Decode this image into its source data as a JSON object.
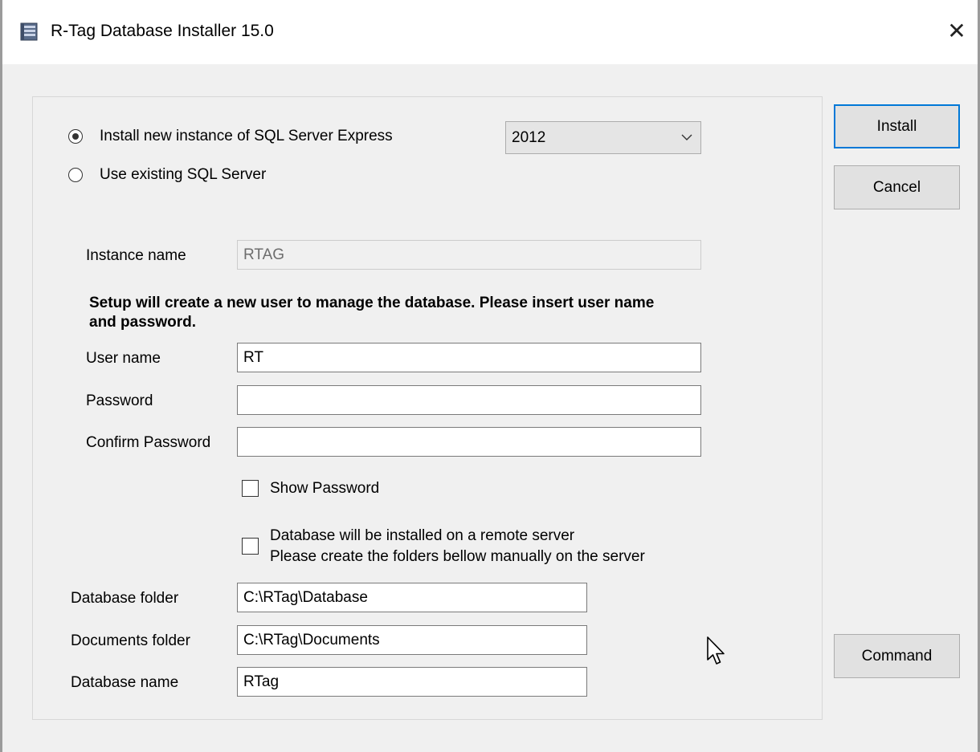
{
  "window": {
    "title": "R-Tag Database Installer 15.0",
    "close_glyph": "✕",
    "icon": "database-icon"
  },
  "install_mode": {
    "new_instance_label": "Install new instance of SQL Server Express",
    "existing_label": "Use existing SQL Server",
    "selected": "new_instance",
    "version_selected": "2012"
  },
  "instance": {
    "label": "Instance name",
    "value": "RTAG"
  },
  "note": "Setup will create a new user to manage the database. Please insert user name and password.",
  "user": {
    "username_label": "User name",
    "username_value": "RT",
    "password_label": "Password",
    "password_value": "",
    "confirm_label": "Confirm Password",
    "confirm_value": ""
  },
  "show_password_label": "Show Password",
  "remote": {
    "line1": "Database will be installed on a remote server",
    "line2": "Please create the folders bellow manually on the server"
  },
  "folders": {
    "database_folder_label": "Database folder",
    "database_folder_value": "C:\\RTag\\Database",
    "documents_folder_label": "Documents folder",
    "documents_folder_value": "C:\\RTag\\Documents",
    "database_name_label": "Database name",
    "database_name_value": "RTag"
  },
  "buttons": {
    "install": "Install",
    "cancel": "Cancel",
    "command": "Command"
  },
  "colors": {
    "accent": "#0078d7",
    "window_bg": "#f0f0f0"
  }
}
